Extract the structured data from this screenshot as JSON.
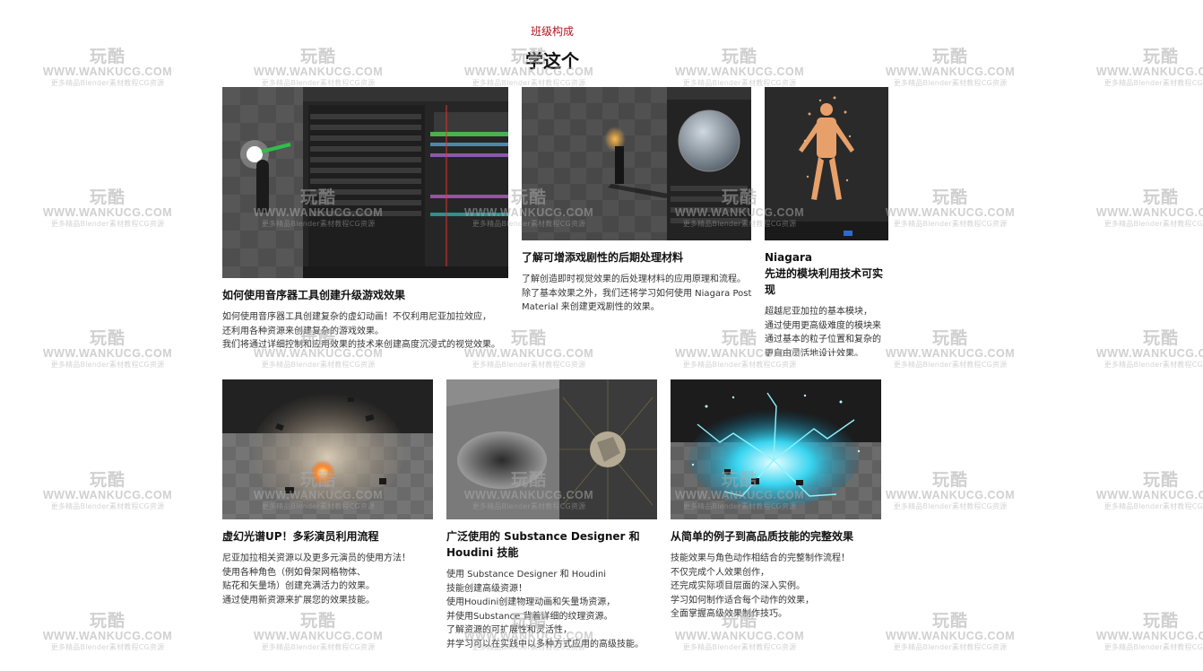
{
  "section": {
    "tag": "班级构成",
    "title": "学这个"
  },
  "watermark": {
    "logo": "玩酷",
    "url": "WWW.WANKUCG.COM",
    "sub": "更多精品Blender素材教程CG资源"
  },
  "cards": [
    {
      "title": "如何使用音序器工具创建升级游戏效果",
      "desc": "如何使用音序器工具创建复杂的虚幻动画！不仅利用尼亚加拉效应，\n还利用各种资源来创建复杂的游戏效果。\n我们将通过详细控制和应用效果的技术来创建高度沉浸式的视觉效果。"
    },
    {
      "title": "了解可增添戏剧性的后期处理材料",
      "desc": "了解创造即时视觉效果的后处理材料的应用原理和流程。\n除了基本效果之外，我们还将学习如何使用 Niagara Post\nMaterial 来创建更戏剧性的效果。"
    },
    {
      "title": "Niagara\n先进的模块利用技术可实现",
      "desc": "超越尼亚加拉的基本模块，\n通过使用更高级难度的模块来\n通过基本的粒子位置和复杂的\n更自由灵活地设计效果。"
    },
    {
      "title": "虚幻光谱UP！多彩演员利用流程",
      "desc": "尼亚加拉相关资源以及更多元演员的使用方法！\n使用各种角色（例如骨架网格物体、\n贴花和矢量场）创建充满活力的效果。\n通过使用新资源来扩展您的效果技能。"
    },
    {
      "title": "广泛使用的 Substance Designer 和\nHoudini 技能",
      "desc": "使用 Substance Designer 和 Houdini\n技能创建高级资源！\n使用Houdini创建物理动画和矢量场资源，\n并使用Substance 背着详细的纹理资源。\n了解资源的可扩展性和灵活性，\n并学习可以在实践中以多种方式应用的高级技能。"
    },
    {
      "title": "从简单的例子到高品质技能的完整效果",
      "desc": "技能效果与角色动作相结合的完整制作流程！\n不仅完成个人效果创作，\n还完成实际项目层面的深入实例。\n学习如何制作适合每个动作的效果，\n全面掌握高级效果制作技巧。"
    }
  ]
}
